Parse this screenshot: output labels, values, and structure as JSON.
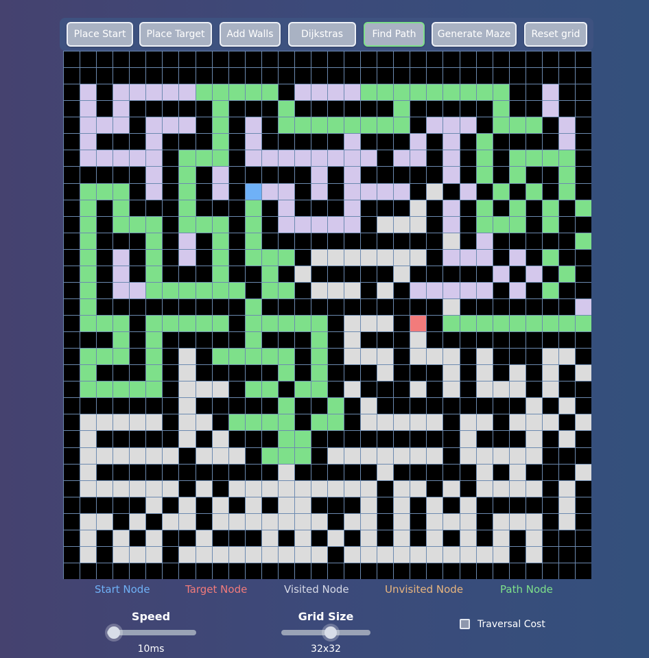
{
  "toolbar": {
    "buttons": [
      {
        "label": "Place Start",
        "name": "place-start-button",
        "active": false
      },
      {
        "label": "Place Target",
        "name": "place-target-button",
        "active": false
      },
      {
        "label": "Add Walls",
        "name": "add-walls-button",
        "active": false
      },
      {
        "label": "Dijkstras",
        "name": "algorithm-select-button",
        "active": false
      },
      {
        "label": "Find Path",
        "name": "find-path-button",
        "active": true
      },
      {
        "label": "Generate Maze",
        "name": "generate-maze-button",
        "active": false
      },
      {
        "label": "Reset grid",
        "name": "reset-grid-button",
        "active": false
      }
    ]
  },
  "colors": {
    "wall": "#000000",
    "unvisited": "#dcdcdc",
    "visited": "#d4c8ec",
    "path": "#7ee08a",
    "start": "#6fb1f7",
    "target": "#f27b7b",
    "grid_line": "#6c8ab0"
  },
  "grid": {
    "size": 32,
    "legend_codes": {
      "#": "wall",
      ".": "unvisited",
      "v": "visited",
      "p": "path",
      "S": "start",
      "T": "target"
    },
    "rows": [
      "################################",
      "################################",
      "#v#vvvvvppppp#vvvvppppppppp##v##",
      "#v#v#####p###p######p#####p##v##",
      "#vvv#vvv#p#v#pppppppp#vvv#ppp#v#",
      "#v###v###p#v#####v###v#v#p####v#",
      "#vvvvv#ppp#vvvvvvvv#vv#v#p#pppp#",
      "#####v#p#v#####v#v#####v#p#p##p#",
      "#ppp#v#p#v#Svv#v#vvvv#.#v#p#p#p#",
      "#p#p###p###p#v###v###.#v#p#p#p#p#",
      "#p#ppp#ppp#p#vvvvv#...#v#ppp#p#",
      "#p###p#v#p#p###########.#v#####p#",
      "#p#v#p#v#p#ppp#.......#vvv#v#p#",
      "#p#v#p###p##p#.#####.#####v#v#p#",
      "#p#vvpppppp#pp#...#.#vvvvv#v#p#",
      "#p#########p###########.#######v#p#",
      "#ppp#ppppp#ppppp#...#T#ppppppppp#",
      "###p#p#####p###p#.###.########",
      "#ppp#p#.#ppppp#p#...#...#.###..#.#",
      "#p###p#.#####p#p###.###.#.#.#.#.#",
      "#ppppp#...#pp#pp#.###.#.#...#.#",
      "#######.#####p##p#.#########.#.#",
      "#.....#..#pppp#pp#.....#..#...#.#",
      "#.#####.#.###pp#########.###.#.#",
      "#......#...#ppp#.......#.....#",
      "#.###########.#####.#####.#.###.#",
      "#......#.#.........#..#.#....#.#",
      "#####.#.#.#.#..###.#.#.#.#####.#",
      "#..#.#..#.......#..#.#...#...#.#",
      "#.#.#.##.###.#.#.#.#.#.#.#.#.#",
      "#.#...#.........#..........#.#",
      "################################"
    ]
  },
  "legend": [
    {
      "label": "Start Node",
      "color": "#6fb1f7",
      "name": "legend-start-node"
    },
    {
      "label": "Target Node",
      "color": "#f27b7b",
      "name": "legend-target-node"
    },
    {
      "label": "Visited Node",
      "color": "#d6d9e6",
      "name": "legend-visited-node"
    },
    {
      "label": "Unvisited Node",
      "color": "#e8b57e",
      "name": "legend-unvisited-node"
    },
    {
      "label": "Path Node",
      "color": "#7ee08a",
      "name": "legend-path-node"
    }
  ],
  "controls": {
    "speed": {
      "label": "Speed",
      "value": "10ms",
      "level": 0.0
    },
    "grid_size": {
      "label": "Grid Size",
      "value": "32x32",
      "level": 0.55
    },
    "traversal_cost": {
      "label": "Traversal Cost",
      "checked": false
    }
  }
}
